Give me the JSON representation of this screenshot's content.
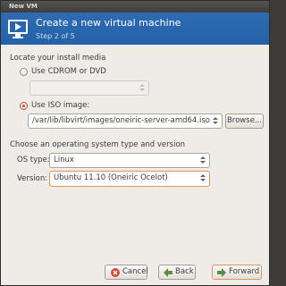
{
  "window": {
    "title": "New VM"
  },
  "header": {
    "title": "Create a new virtual machine",
    "step": "Step 2 of 5",
    "icon": "monitor-icon"
  },
  "install_media": {
    "section_label": "Locate your install media",
    "cdrom_label": "Use CDROM or DVD",
    "cdrom_selected": false,
    "cdrom_device": "",
    "iso_label": "Use ISO image:",
    "iso_selected": true,
    "iso_path": "/var/lib/libvirt/images/oneiric-server-amd64.iso",
    "browse_label": "Browse..."
  },
  "os_section": {
    "section_label": "Choose an operating system type and version",
    "os_type_label": "OS type:",
    "os_type_value": "Linux",
    "version_label": "Version:",
    "version_value": "Ubuntu 11.10 (Oneiric Ocelot)"
  },
  "footer": {
    "cancel_label": "Cancel",
    "back_label": "Back",
    "forward_label": "Forward"
  },
  "colors": {
    "header_blue": "#2a65ad",
    "focus_orange": "#e0935f",
    "radio_accent": "#c24b26"
  }
}
